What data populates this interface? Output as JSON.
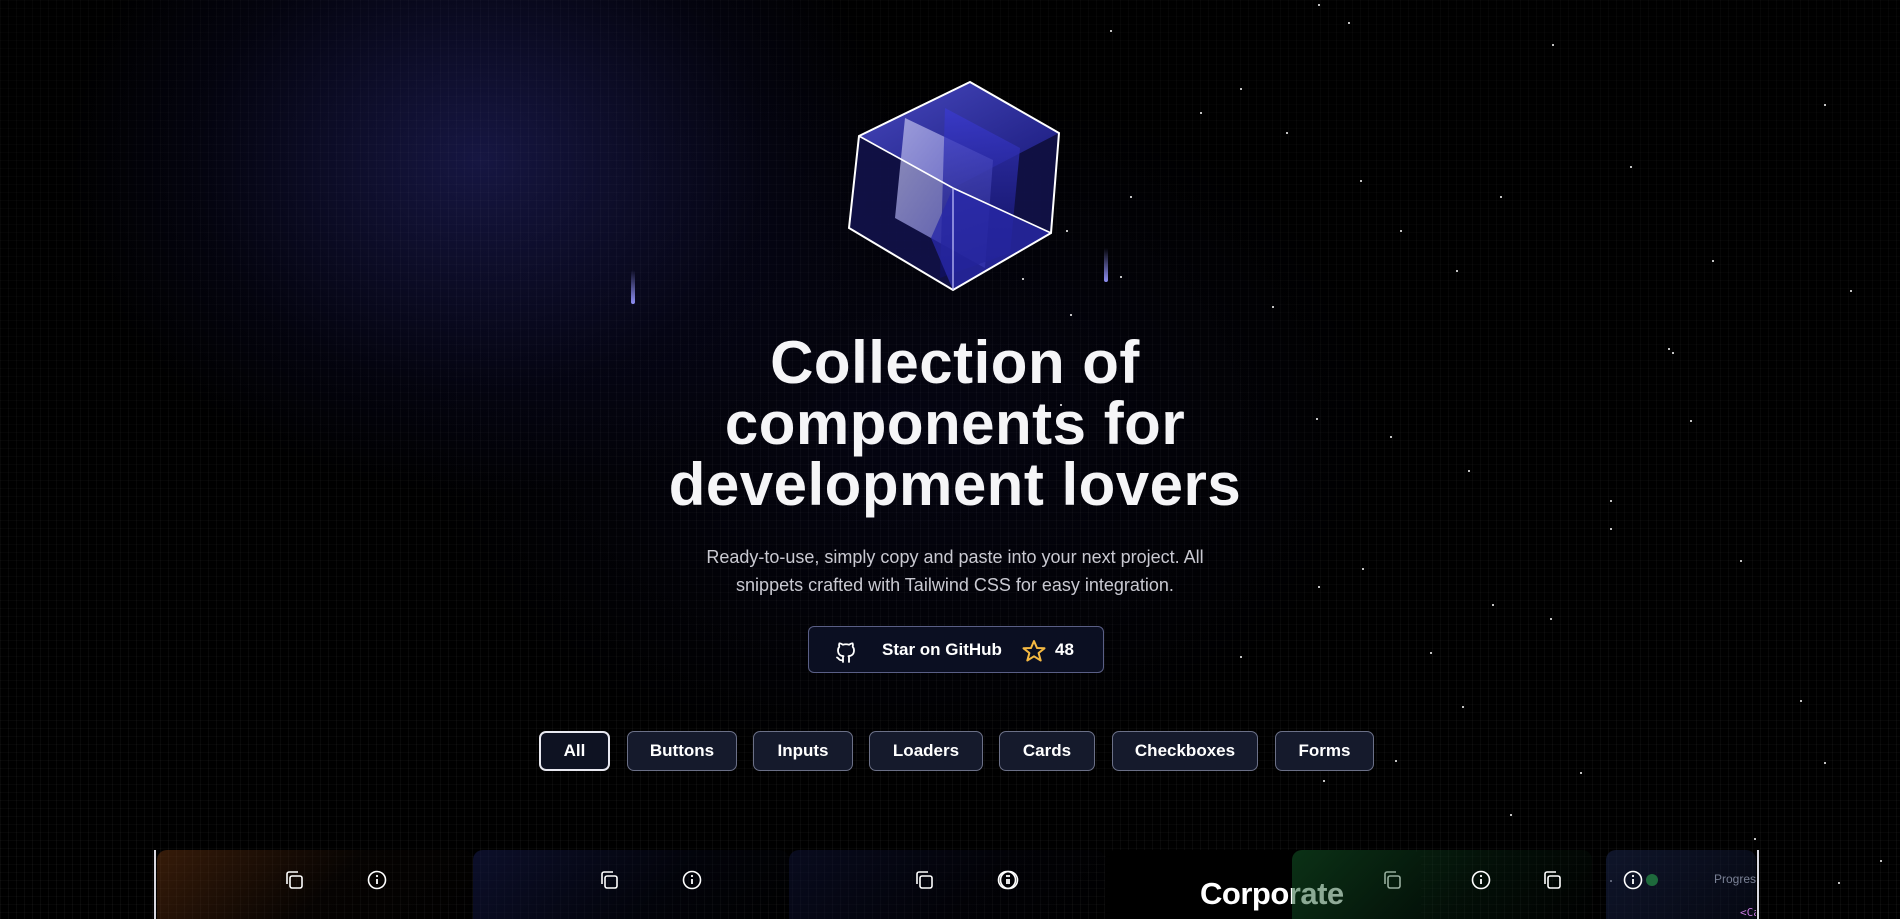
{
  "hero": {
    "title_line1": "Collection of",
    "title_line2": "components for",
    "title_line3": "development lovers",
    "subtitle_line1": "Ready-to-use, simply copy and paste into your next project. All",
    "subtitle_line2": "snippets crafted with Tailwind CSS for easy integration."
  },
  "github": {
    "label": "Star on GitHub",
    "stars": "48",
    "icon": "github-icon",
    "star_icon": "star-icon",
    "star_color": "#f5b942"
  },
  "filters": [
    "All",
    "Buttons",
    "Inputs",
    "Loaders",
    "Cards",
    "Checkboxes",
    "Forms"
  ],
  "active_filter": "All",
  "cards": {
    "corporate_text": "Corporate",
    "partial_label": "Progres",
    "partial_code": "<Ca",
    "tool_icons": [
      "copy-icon",
      "info-icon"
    ]
  },
  "colors": {
    "background": "#000000",
    "accent_indigo": "#4a4ae8",
    "chip_bg": "#151a2c",
    "chip_border": "#6b7087"
  }
}
